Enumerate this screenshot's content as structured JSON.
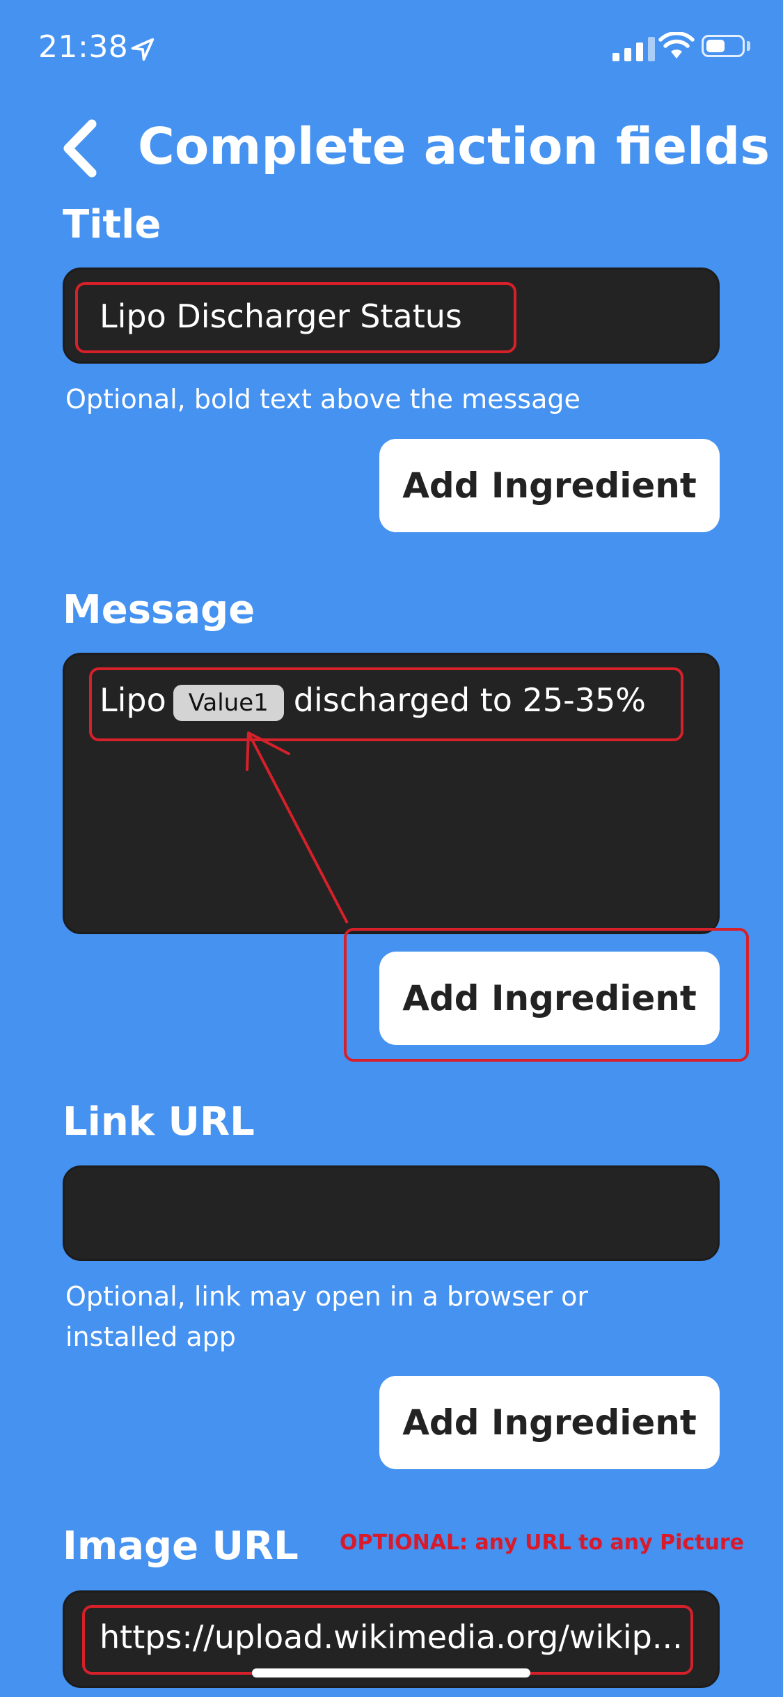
{
  "status_bar": {
    "time": "21:38"
  },
  "header": {
    "title": "Complete action fields"
  },
  "title_field": {
    "label": "Title",
    "value": "Lipo Discharger Status",
    "hint": "Optional, bold text above the message",
    "button_label": "Add Ingredient"
  },
  "message_field": {
    "label": "Message",
    "text_before": "Lipo",
    "ingredient": "Value1",
    "text_after": "discharged to 25-35%",
    "button_label": "Add Ingredient"
  },
  "link_field": {
    "label": "Link URL",
    "value": "",
    "hint_line1": "Optional, link may open in a browser or",
    "hint_line2": "installed app",
    "button_label": "Add Ingredient"
  },
  "image_field": {
    "label": "Image URL",
    "annotation": "OPTIONAL: any URL to any Picture",
    "value": "https://upload.wikimedia.org/wikip..."
  },
  "annotation_color": "#d6202a"
}
